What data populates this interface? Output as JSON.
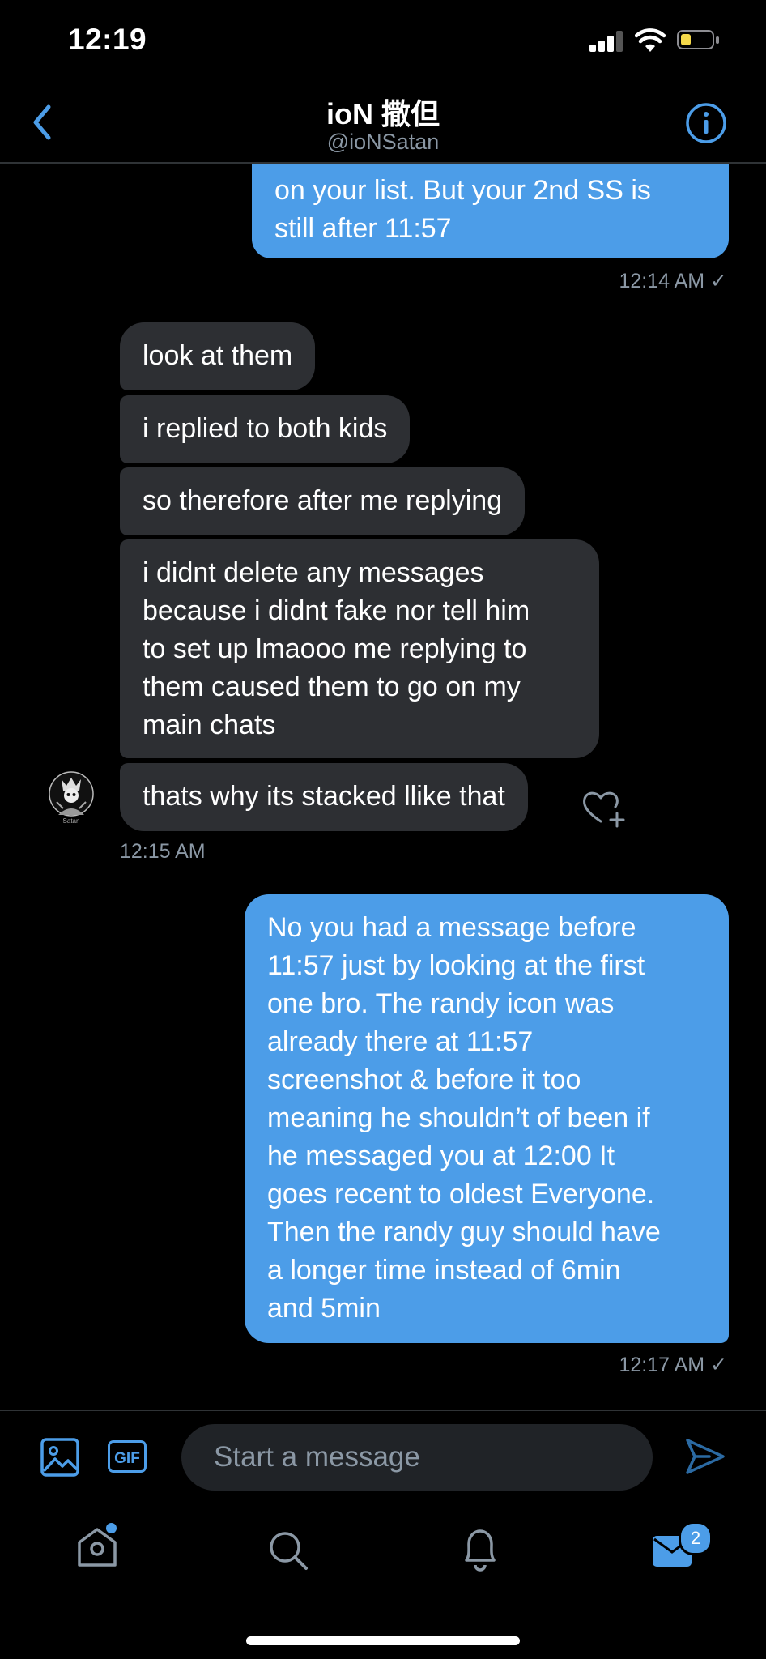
{
  "status_bar": {
    "time": "12:19"
  },
  "header": {
    "title": "ioN 撒但",
    "handle": "@ioNSatan"
  },
  "messages": [
    {
      "lines": [
        "on your list.  But your 2nd SS is",
        "still after 11:57"
      ]
    },
    {
      "timestamp": "12:14 AM ✓"
    },
    {
      "text": "look at them"
    },
    {
      "text": "i replied to both kids"
    },
    {
      "text": "so therefore after me replying"
    },
    {
      "lines": [
        "i didnt delete any messages",
        "because i didnt fake nor tell him",
        "to set up lmaooo me replying to",
        "them caused them to go on my",
        "main chats"
      ]
    },
    {
      "text": "thats why its stacked llike that"
    },
    {
      "timestamp": "12:15 AM"
    },
    {
      "lines": [
        "No you had a message before",
        "11:57 just by looking at the first",
        "one bro.  The randy icon was",
        "already there at 11:57",
        "screenshot & before it too",
        "meaning he shouldn’t of been if",
        "he messaged you at 12:00 It",
        "goes recent to oldest Everyone.",
        "Then the randy guy should have",
        "a longer time instead of 6min",
        "and 5min"
      ]
    },
    {
      "timestamp": "12:17 AM ✓"
    }
  ],
  "avatar_caption": "Satan",
  "compose": {
    "placeholder": "Start a message",
    "gif_label": "GIF"
  },
  "tab_bar": {
    "messages_badge": "2"
  },
  "colors": {
    "accent": "#4c9de8",
    "incoming_bubble": "#2d2f33",
    "background": "#000000",
    "battery": "#f5d94a"
  },
  "icons": [
    "back-chevron-icon",
    "info-icon",
    "image-icon",
    "gif-icon",
    "send-icon",
    "home-icon",
    "search-icon",
    "bell-icon",
    "mail-icon"
  ]
}
